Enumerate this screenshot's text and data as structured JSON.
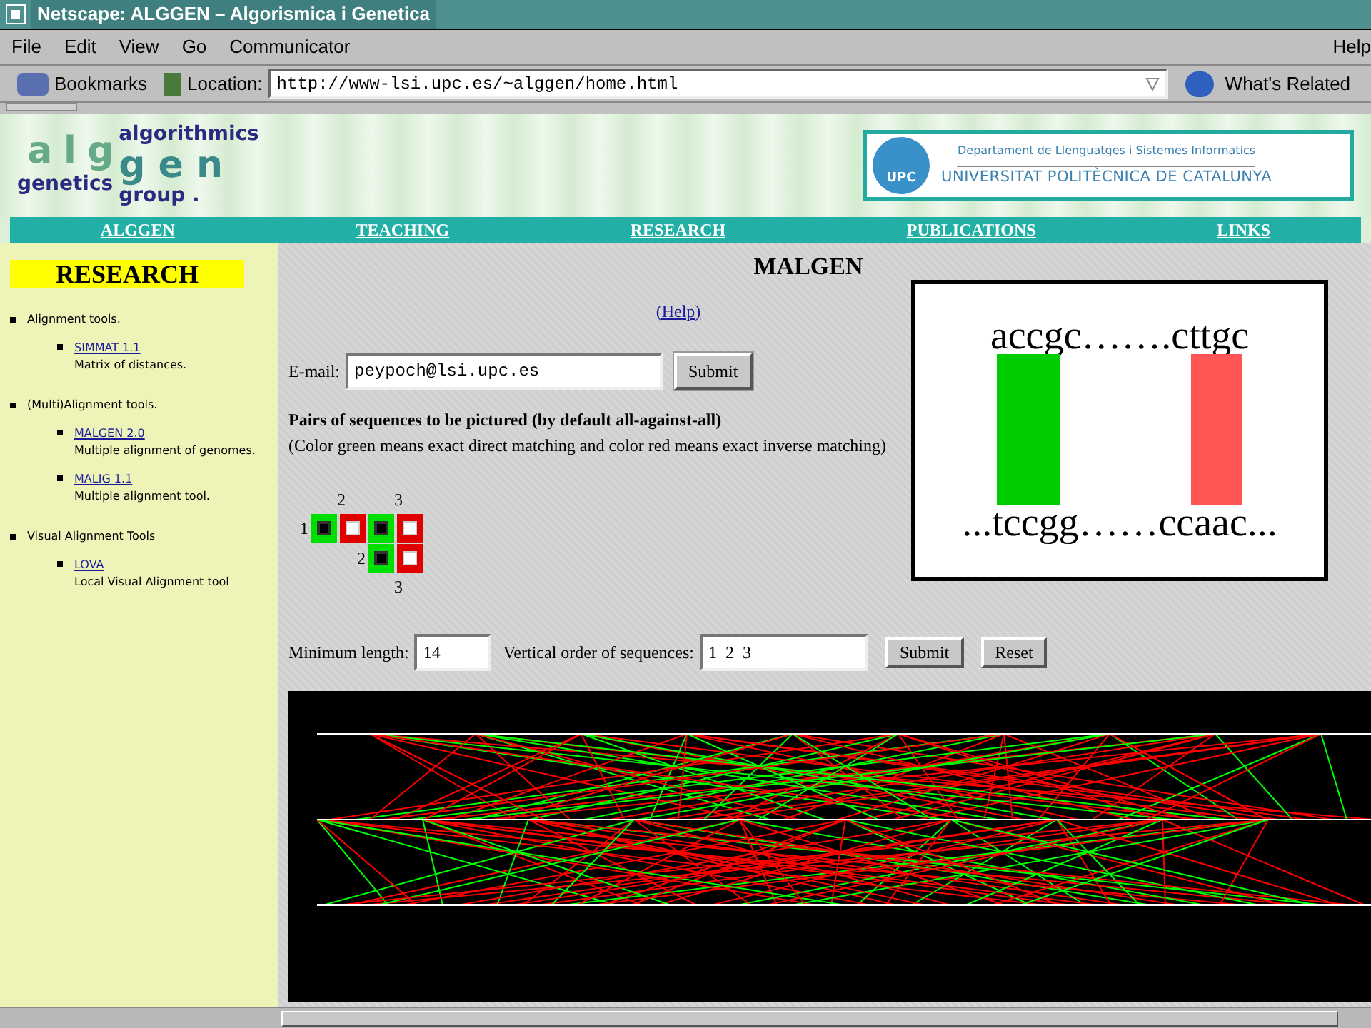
{
  "window": {
    "title": "Netscape: ALGGEN – Algorismica i Genetica"
  },
  "menu": [
    "File",
    "Edit",
    "View",
    "Go",
    "Communicator",
    "Help"
  ],
  "toolbar": {
    "bookmarks": "Bookmarks",
    "location_label": "Location:",
    "url": "http://www-lsi.upc.es/~alggen/home.html",
    "related": "What's Related"
  },
  "header": {
    "logo": {
      "letters_top": "a l g",
      "letters_bottom": "g e n",
      "word_1": "algorithmics",
      "word_2": "genetics",
      "word_3": "group ."
    },
    "university": {
      "mark": "UPC",
      "department": "Departament de Llenguatges i Sistemes Informatics",
      "name": "UNIVERSITAT POLITÈCNICA DE CATALUNYA"
    }
  },
  "nav": [
    "ALGGEN",
    "TEACHING",
    "RESEARCH",
    "PUBLICATIONS",
    "LINKS"
  ],
  "sidebar": {
    "title": "RESEARCH",
    "sections": [
      {
        "label": "Alignment tools.",
        "children": [
          {
            "link": "SIMMAT 1.1",
            "description": "Matrix of distances."
          }
        ]
      },
      {
        "label": "(Multi)Alignment tools.",
        "children": [
          {
            "link": "MALGEN 2.0",
            "description": "Multiple alignment of genomes."
          },
          {
            "link": "MALIG 1.1",
            "description": "Multiple alignment tool."
          }
        ]
      },
      {
        "label": "Visual Alignment Tools",
        "children": [
          {
            "link": "LOVA",
            "description": "Local Visual Alignment tool"
          }
        ]
      }
    ]
  },
  "main": {
    "title": "MALGEN",
    "help": "(Help)",
    "email": {
      "label": "E-mail:",
      "value": "peypoch@lsi.upc.es",
      "button": "Submit"
    },
    "pairs_heading": "Pairs of sequences to be pictured (by default all-against-all)",
    "pairs_note": "(Color green means exact direct matching and color red means exact inverse matching)",
    "matrix": {
      "columns": [
        "2",
        "3"
      ],
      "rows": [
        {
          "label": "1",
          "boxes": [
            {
              "color": "#00e000",
              "checked": true
            },
            {
              "color": "#e00000",
              "checked": false
            },
            {
              "color": "#00e000",
              "checked": true
            },
            {
              "color": "#e00000",
              "checked": false
            }
          ]
        },
        {
          "label": "2",
          "boxes": [
            {
              "color": "#00e000",
              "checked": true
            },
            {
              "color": "#e00000",
              "checked": false
            }
          ]
        }
      ],
      "last": "3"
    },
    "min_length": {
      "label": "Minimum length:",
      "value": "14"
    },
    "order": {
      "label": "Vertical order of sequences:",
      "value": "1  2  3"
    },
    "buttons": [
      "Submit",
      "Reset"
    ],
    "figure": {
      "top": "accgc…….cttgc",
      "bottom": "...tccgg……ccaac..."
    }
  }
}
